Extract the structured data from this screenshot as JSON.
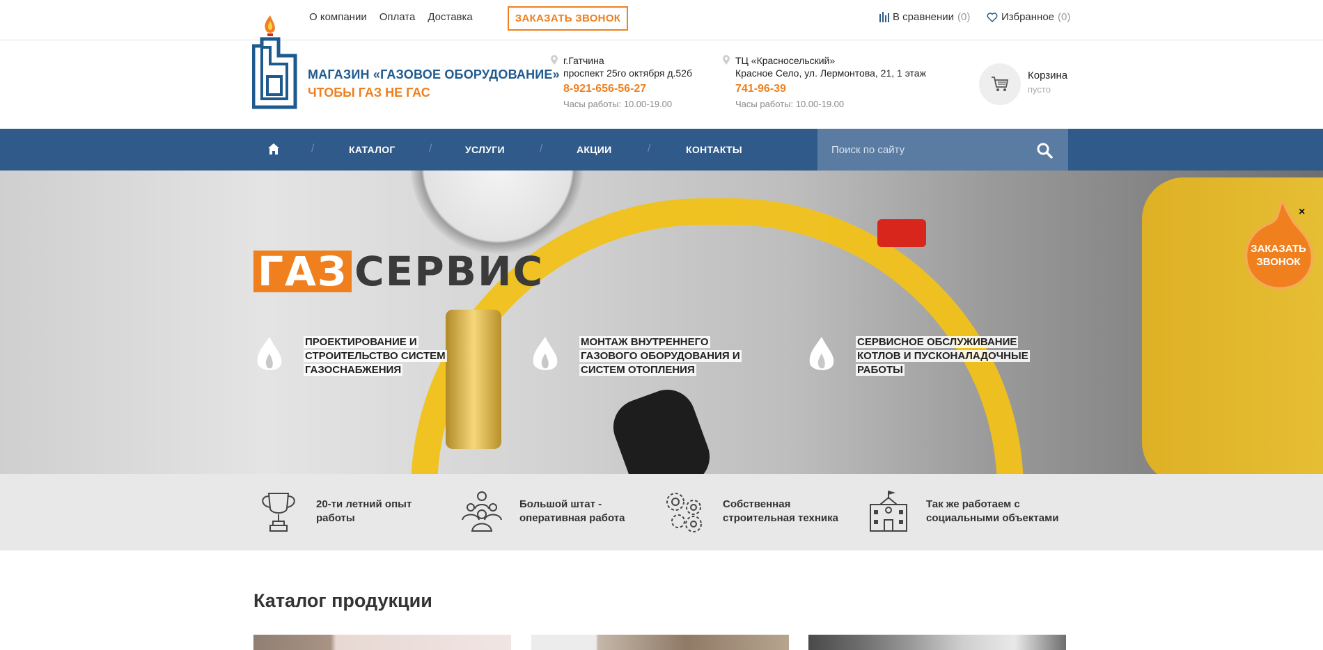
{
  "topbar": {
    "links": [
      "О компании",
      "Оплата",
      "Доставка"
    ],
    "order_call": "ЗАКАЗАТЬ ЗВОНОК",
    "compare_label": "В сравнении",
    "compare_count": "(0)",
    "favorites_label": "Избранное",
    "favorites_count": "(0)"
  },
  "header": {
    "logo_title": "МАГАЗИН «ГАЗОВОЕ ОБОРУДОВАНИЕ»",
    "logo_sub": "ЧТОБЫ ГАЗ НЕ ГАС",
    "stores": [
      {
        "line1": "г.Гатчина",
        "line2": "проспект 25го октября д.52б",
        "phone": "8-921-656-56-27",
        "hours": "Часы работы: 10.00-19.00"
      },
      {
        "line1": "ТЦ «Красносельский»",
        "line2": "Красное Село, ул. Лермонтова, 21, 1 этаж",
        "phone": "741-96-39",
        "hours": "Часы работы: 10.00-19.00"
      }
    ],
    "cart_label": "Корзина",
    "cart_status": "пусто"
  },
  "nav": {
    "items": [
      "КАТАЛОГ",
      "УСЛУГИ",
      "АКЦИИ",
      "КОНТАКТЫ"
    ],
    "search_placeholder": "Поиск по сайту"
  },
  "banner": {
    "brand_orange": "ГАЗ",
    "brand_dark": "СЕРВИС",
    "features": [
      "ПРОЕКТИРОВАНИЕ И СТРОИТЕЛЬСТВО СИСТЕМ ГАЗОСНАБЖЕНИЯ",
      "МОНТАЖ ВНУТРЕННЕГО ГАЗОВОГО ОБОРУДОВАНИЯ И СИСТЕМ ОТОПЛЕНИЯ",
      "СЕРВИСНОЕ ОБСЛУЖИВАНИЕ КОТЛОВ И ПУСКОНАЛАДОЧНЫЕ РАБОТЫ"
    ]
  },
  "callback": {
    "line1": "ЗАКАЗАТЬ",
    "line2": "ЗВОНОК",
    "close": "×"
  },
  "advantages": [
    {
      "icon": "trophy-icon",
      "line1": "20-ти летний опыт",
      "line2": "работы"
    },
    {
      "icon": "team-icon",
      "line1": "Большой штат -",
      "line2": "оперативная работа"
    },
    {
      "icon": "gears-icon",
      "line1": "Собственная",
      "line2": "строительная техника"
    },
    {
      "icon": "school-icon",
      "line1": "Так же работаем с",
      "line2": "социальными объектами"
    }
  ],
  "catalog": {
    "title": "Каталог продукции"
  },
  "colors": {
    "accent": "#f07f1e",
    "nav": "#2f5a8a",
    "brand_blue": "#1f5a8e"
  }
}
